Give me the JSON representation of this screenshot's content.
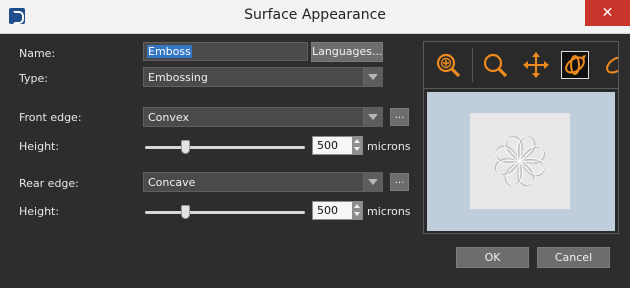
{
  "window": {
    "title": "Surface Appearance",
    "close_glyph": "✕",
    "app_icon": "app-logo-icon"
  },
  "form": {
    "name_label": "Name:",
    "name_value": "Emboss",
    "languages_button": "Languages...",
    "type_label": "Type:",
    "type_value": "Embossing",
    "front_edge_label": "Front edge:",
    "front_edge_value": "Convex",
    "front_height_label": "Height:",
    "front_height_value": "500",
    "front_height_unit": "microns",
    "rear_edge_label": "Rear edge:",
    "rear_edge_value": "Concave",
    "rear_height_label": "Height:",
    "rear_height_value": "500",
    "rear_height_unit": "microns",
    "ellipsis_label": "..."
  },
  "sliders": {
    "front_fraction": 0.25,
    "rear_fraction": 0.25
  },
  "preview_toolbar": {
    "tools": [
      "zoom-region-icon",
      "zoom-icon",
      "pan-icon",
      "rotate-icon",
      "rotate-partial-icon"
    ],
    "active_tool": "rotate-icon",
    "icon_color": "#f08a1c"
  },
  "buttons": {
    "ok": "OK",
    "cancel": "Cancel"
  }
}
